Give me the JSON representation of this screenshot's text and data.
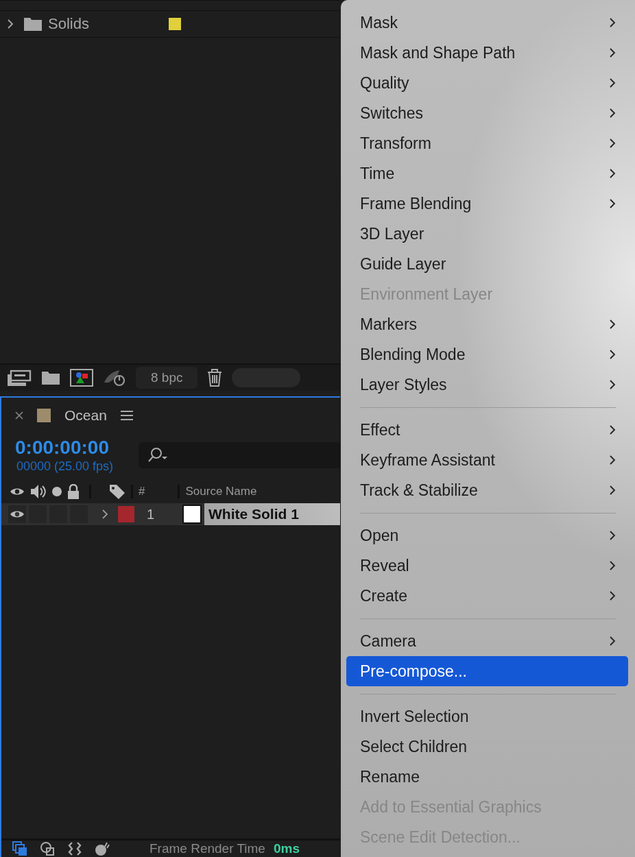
{
  "project_panel": {
    "items": [
      {
        "name": "Solids",
        "expanded": false,
        "color": "#e0d03c"
      }
    ]
  },
  "project_toolbar": {
    "bit_depth": "8 bpc"
  },
  "timeline": {
    "comp_name": "Ocean",
    "timecode": "0:00:00:00",
    "frame_info": "00000 (25.00 fps)",
    "columns": [
      "#",
      "Source Name"
    ],
    "layers": [
      {
        "number": "1",
        "name": "White Solid 1",
        "color": "#a5262d",
        "selected": true,
        "visible": true,
        "expanded": false
      }
    ]
  },
  "status_bar": {
    "label": "Frame Render Time",
    "value": "0ms"
  },
  "context_menu": [
    {
      "kind": "item",
      "label": "Mask",
      "submenu": true,
      "disabled": false,
      "selected": false
    },
    {
      "kind": "item",
      "label": "Mask and Shape Path",
      "submenu": true,
      "disabled": false,
      "selected": false
    },
    {
      "kind": "item",
      "label": "Quality",
      "submenu": true,
      "disabled": false,
      "selected": false
    },
    {
      "kind": "item",
      "label": "Switches",
      "submenu": true,
      "disabled": false,
      "selected": false
    },
    {
      "kind": "item",
      "label": "Transform",
      "submenu": true,
      "disabled": false,
      "selected": false
    },
    {
      "kind": "item",
      "label": "Time",
      "submenu": true,
      "disabled": false,
      "selected": false
    },
    {
      "kind": "item",
      "label": "Frame Blending",
      "submenu": true,
      "disabled": false,
      "selected": false
    },
    {
      "kind": "item",
      "label": "3D Layer",
      "submenu": false,
      "disabled": false,
      "selected": false
    },
    {
      "kind": "item",
      "label": "Guide Layer",
      "submenu": false,
      "disabled": false,
      "selected": false
    },
    {
      "kind": "item",
      "label": "Environment Layer",
      "submenu": false,
      "disabled": true,
      "selected": false
    },
    {
      "kind": "item",
      "label": "Markers",
      "submenu": true,
      "disabled": false,
      "selected": false
    },
    {
      "kind": "item",
      "label": "Blending Mode",
      "submenu": true,
      "disabled": false,
      "selected": false
    },
    {
      "kind": "item",
      "label": "Layer Styles",
      "submenu": true,
      "disabled": false,
      "selected": false
    },
    {
      "kind": "separator"
    },
    {
      "kind": "item",
      "label": "Effect",
      "submenu": true,
      "disabled": false,
      "selected": false
    },
    {
      "kind": "item",
      "label": "Keyframe Assistant",
      "submenu": true,
      "disabled": false,
      "selected": false
    },
    {
      "kind": "item",
      "label": "Track & Stabilize",
      "submenu": true,
      "disabled": false,
      "selected": false
    },
    {
      "kind": "separator"
    },
    {
      "kind": "item",
      "label": "Open",
      "submenu": true,
      "disabled": false,
      "selected": false
    },
    {
      "kind": "item",
      "label": "Reveal",
      "submenu": true,
      "disabled": false,
      "selected": false
    },
    {
      "kind": "item",
      "label": "Create",
      "submenu": true,
      "disabled": false,
      "selected": false
    },
    {
      "kind": "separator"
    },
    {
      "kind": "item",
      "label": "Camera",
      "submenu": true,
      "disabled": false,
      "selected": false
    },
    {
      "kind": "item",
      "label": "Pre-compose...",
      "submenu": false,
      "disabled": false,
      "selected": true
    },
    {
      "kind": "separator"
    },
    {
      "kind": "item",
      "label": "Invert Selection",
      "submenu": false,
      "disabled": false,
      "selected": false
    },
    {
      "kind": "item",
      "label": "Select Children",
      "submenu": false,
      "disabled": false,
      "selected": false
    },
    {
      "kind": "item",
      "label": "Rename",
      "submenu": false,
      "disabled": false,
      "selected": false
    },
    {
      "kind": "item",
      "label": "Add to Essential Graphics",
      "submenu": false,
      "disabled": true,
      "selected": false
    },
    {
      "kind": "item",
      "label": "Scene Edit Detection...",
      "submenu": false,
      "disabled": true,
      "selected": false
    }
  ]
}
